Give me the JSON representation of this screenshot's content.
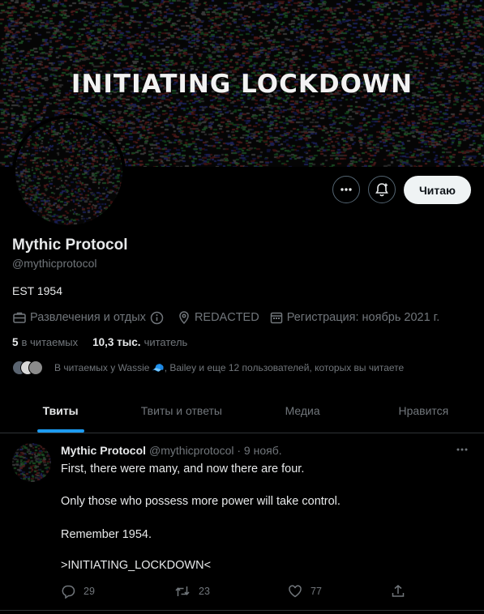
{
  "banner": {
    "title": "INITIATING LOCKDOWN"
  },
  "profile": {
    "name": "Mythic Protocol",
    "handle": "@mythicprotocol",
    "bio": "EST 1954",
    "category": "Развлечения и отдых",
    "location": "REDACTED",
    "joined": "Регистрация: ноябрь 2021 г.",
    "following_count": "5",
    "following_label": "в читаемых",
    "followers_count": "10,3 тыс.",
    "followers_label": "читатель",
    "followed_by": "В читаемых у Wassie 🧢, Bailey и еще 12 пользователей, которых вы читаете"
  },
  "actions": {
    "follow_label": "Читаю"
  },
  "tabs": [
    {
      "label": "Твиты",
      "active": true
    },
    {
      "label": "Твиты и ответы"
    },
    {
      "label": "Медиа"
    },
    {
      "label": "Нравится"
    }
  ],
  "tweet": {
    "author": "Mythic Protocol",
    "handle_time": "@mythicprotocol · 9 нояб.",
    "lines": [
      "First, there were many, and now there are four.",
      "Only those who possess more power will take control.",
      "Remember 1954.",
      ">INITIATING_LOCKDOWN<"
    ],
    "replies": "29",
    "retweets": "23",
    "likes": "77"
  },
  "icons": [
    "more-icon",
    "notification-bell-icon",
    "briefcase-icon",
    "info-icon",
    "location-pin-icon",
    "calendar-icon",
    "reply-icon",
    "retweet-icon",
    "like-icon",
    "share-icon"
  ],
  "colors": {
    "accent": "#1d9bf0",
    "background": "#000000",
    "muted": "#71767b",
    "text": "#e7e9ea"
  }
}
